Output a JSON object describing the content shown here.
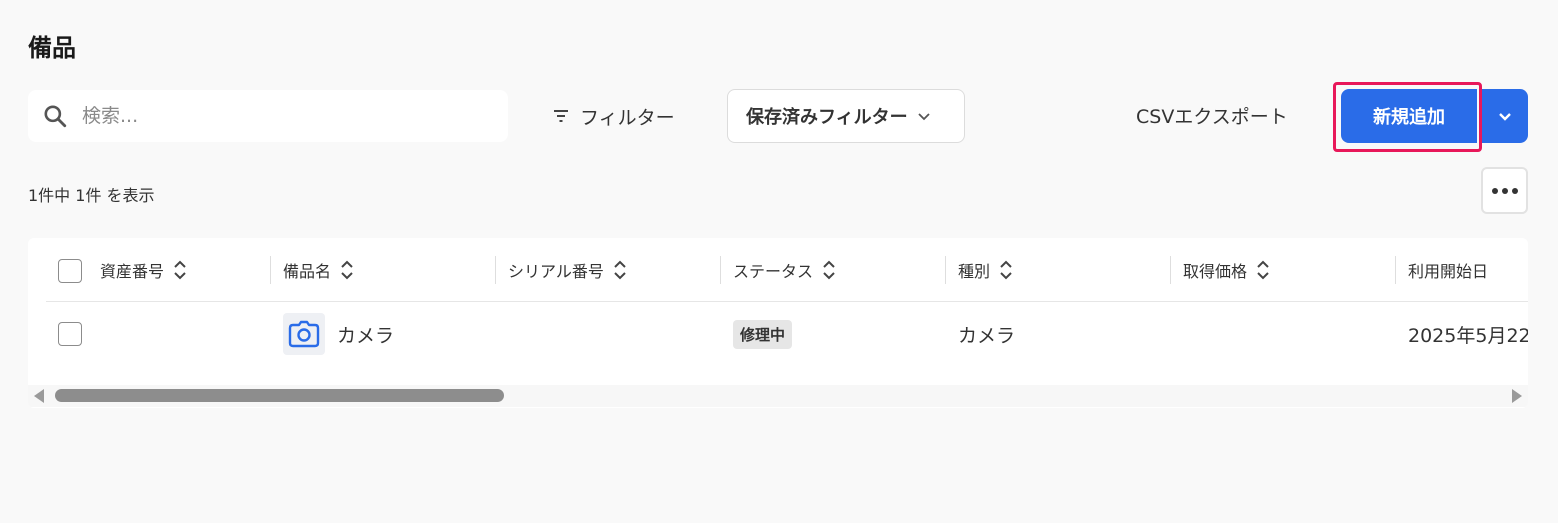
{
  "page": {
    "title": "備品"
  },
  "toolbar": {
    "search_placeholder": "検索...",
    "filter_label": "フィルター",
    "saved_filter_label": "保存済みフィルター",
    "csv_export_label": "CSVエクスポート",
    "add_label": "新規追加"
  },
  "results": {
    "count_text": "1件中 1件 を表示"
  },
  "table": {
    "columns": [
      {
        "label": "資産番号",
        "sortable": true
      },
      {
        "label": "備品名",
        "sortable": true
      },
      {
        "label": "シリアル番号",
        "sortable": true
      },
      {
        "label": "ステータス",
        "sortable": true
      },
      {
        "label": "種別",
        "sortable": true
      },
      {
        "label": "取得価格",
        "sortable": true
      },
      {
        "label": "利用開始日",
        "sortable": false
      }
    ],
    "rows": [
      {
        "asset_number": "",
        "name": "カメラ",
        "icon": "camera-icon",
        "serial_number": "",
        "status": "修理中",
        "type": "カメラ",
        "acquisition_price": "",
        "start_date": "2025年5月22"
      }
    ]
  },
  "colors": {
    "primary": "#2a6ce8",
    "highlight_border": "#e8185a",
    "background": "#f9f9f9"
  }
}
